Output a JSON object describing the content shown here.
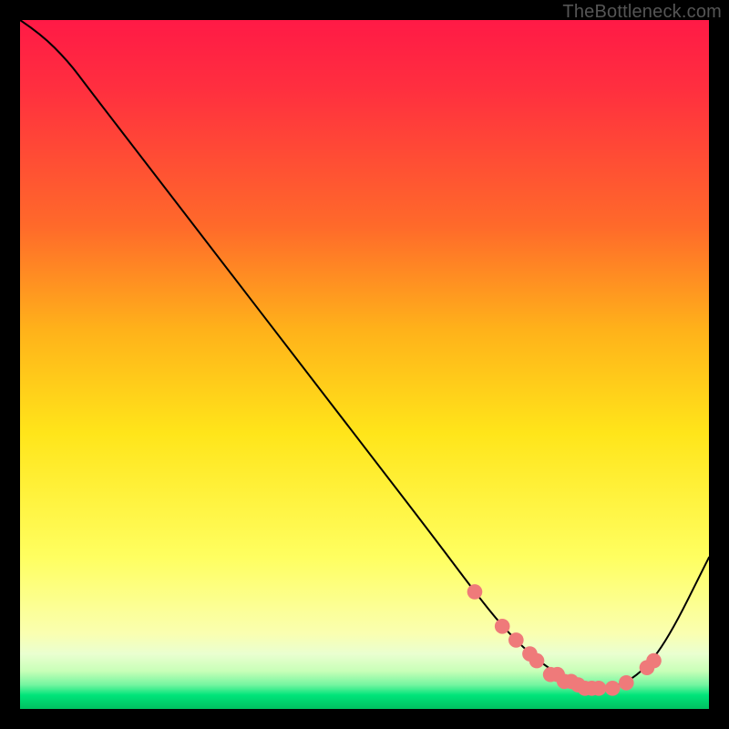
{
  "watermark": "TheBottleneck.com",
  "chart_data": {
    "type": "line",
    "title": "",
    "xlabel": "",
    "ylabel": "",
    "xlim": [
      0,
      100
    ],
    "ylim": [
      0,
      100
    ],
    "grid": false,
    "legend": false,
    "gradient_stops": [
      {
        "pos": 0,
        "color": "#ff1a46"
      },
      {
        "pos": 10,
        "color": "#ff2f3f"
      },
      {
        "pos": 30,
        "color": "#ff6a2a"
      },
      {
        "pos": 45,
        "color": "#ffb21a"
      },
      {
        "pos": 60,
        "color": "#ffe51a"
      },
      {
        "pos": 78,
        "color": "#ffff60"
      },
      {
        "pos": 89,
        "color": "#faffb0"
      },
      {
        "pos": 92,
        "color": "#eaffd0"
      },
      {
        "pos": 94.5,
        "color": "#c8ffb8"
      },
      {
        "pos": 96.5,
        "color": "#74f5a0"
      },
      {
        "pos": 98,
        "color": "#00e47a"
      },
      {
        "pos": 100,
        "color": "#00c060"
      }
    ],
    "series": [
      {
        "name": "curve",
        "color": "#000000",
        "x": [
          0,
          3,
          7,
          10,
          20,
          30,
          40,
          50,
          60,
          66,
          70,
          74,
          78,
          82,
          86,
          90,
          94,
          100
        ],
        "y": [
          100,
          98,
          94,
          90,
          77,
          64,
          51,
          38,
          25,
          17,
          12,
          8,
          5,
          3,
          3,
          5,
          10,
          22
        ]
      }
    ],
    "markers": {
      "name": "highlight-dots",
      "color": "#ef7a7a",
      "radius": 1.1,
      "x": [
        66,
        70,
        72,
        74,
        75,
        77,
        78,
        79,
        80,
        81,
        82,
        83,
        84,
        86,
        88,
        91,
        92
      ],
      "y": [
        17,
        12,
        10,
        8,
        7,
        5,
        5,
        4,
        4,
        3.5,
        3,
        3,
        3,
        3,
        3.8,
        6,
        7
      ]
    }
  }
}
